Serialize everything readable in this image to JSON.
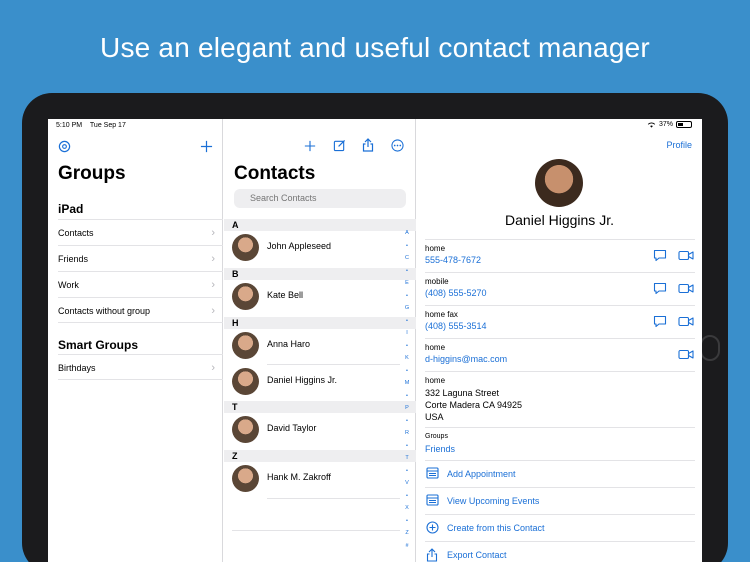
{
  "headline": "Use an elegant and useful contact manager",
  "status": {
    "time": "5:10 PM",
    "date": "Tue Sep 17",
    "battery": "37%"
  },
  "groups": {
    "title": "Groups",
    "section_ipad": "iPad",
    "items": [
      "Contacts",
      "Friends",
      "Work",
      "Contacts without group"
    ],
    "section_smart": "Smart Groups",
    "smart_items": [
      "Birthdays"
    ]
  },
  "contacts": {
    "title": "Contacts",
    "search_placeholder": "Search Contacts",
    "sections": [
      {
        "letter": "A",
        "names": [
          "John Appleseed"
        ]
      },
      {
        "letter": "B",
        "names": [
          "Kate Bell"
        ]
      },
      {
        "letter": "H",
        "names": [
          "Anna Haro",
          "Daniel Higgins Jr."
        ]
      },
      {
        "letter": "T",
        "names": [
          "David Taylor"
        ]
      },
      {
        "letter": "Z",
        "names": [
          "Hank M. Zakroff"
        ]
      }
    ],
    "index": [
      "A",
      "•",
      "C",
      "•",
      "E",
      "•",
      "G",
      "•",
      "I",
      "•",
      "K",
      "•",
      "M",
      "•",
      "P",
      "•",
      "R",
      "•",
      "T",
      "•",
      "V",
      "•",
      "X",
      "•",
      "Z",
      "#"
    ]
  },
  "detail": {
    "profile_label": "Profile",
    "name": "Daniel Higgins Jr.",
    "phones": [
      {
        "label": "home",
        "value": "555-478-7672"
      },
      {
        "label": "mobile",
        "value": "(408) 555-5270"
      },
      {
        "label": "home fax",
        "value": "(408) 555-3514"
      }
    ],
    "email": {
      "label": "home",
      "value": "d-higgins@mac.com"
    },
    "address": {
      "label": "home",
      "line1": "332 Laguna Street",
      "line2": "Corte Madera CA 94925",
      "line3": "USA"
    },
    "groups": {
      "label": "Groups",
      "value": "Friends"
    },
    "actions": [
      "Add Appointment",
      "View Upcoming Events",
      "Create from this Contact",
      "Export Contact"
    ]
  },
  "colors": {
    "background": "#3a8fcb",
    "accent": "#1a6fd6"
  }
}
